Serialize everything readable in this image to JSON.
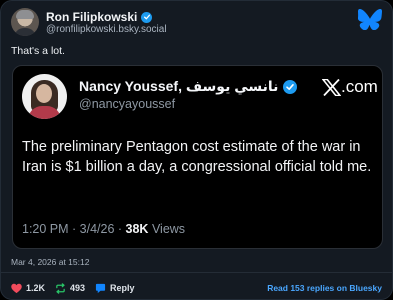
{
  "post": {
    "author_name": "Ron Filipkowski",
    "author_handle": "@ronfilipkowski.bsky.social",
    "text": "That's a lot.",
    "timestamp": "Mar 4, 2026 at 15:12"
  },
  "embed": {
    "author_name": "Nancy Youssef, نانسي يوسف",
    "author_handle": "@nancyayoussef",
    "source_label": ".com",
    "text": "The preliminary Pentagon cost estimate of the war in Iran is $1 billion a day, a congressional official told me.",
    "time": "1:20 PM · 3/4/26 · ",
    "views_count": "38K",
    "views_label": " Views"
  },
  "actions": {
    "likes": "1.2K",
    "reposts": "493",
    "reply_label": "Reply",
    "read_replies_label": "Read 153 replies on Bluesky"
  },
  "colors": {
    "background": "#141a22",
    "accent_blue": "#1d9bf0",
    "like_red": "#f24b5c",
    "repost_green": "#29c467",
    "link_blue": "#4aa7ff"
  },
  "icons": [
    "verified-badge-icon",
    "bluesky-butterfly-icon",
    "x-logo-icon",
    "heart-icon",
    "repost-icon",
    "reply-icon"
  ]
}
